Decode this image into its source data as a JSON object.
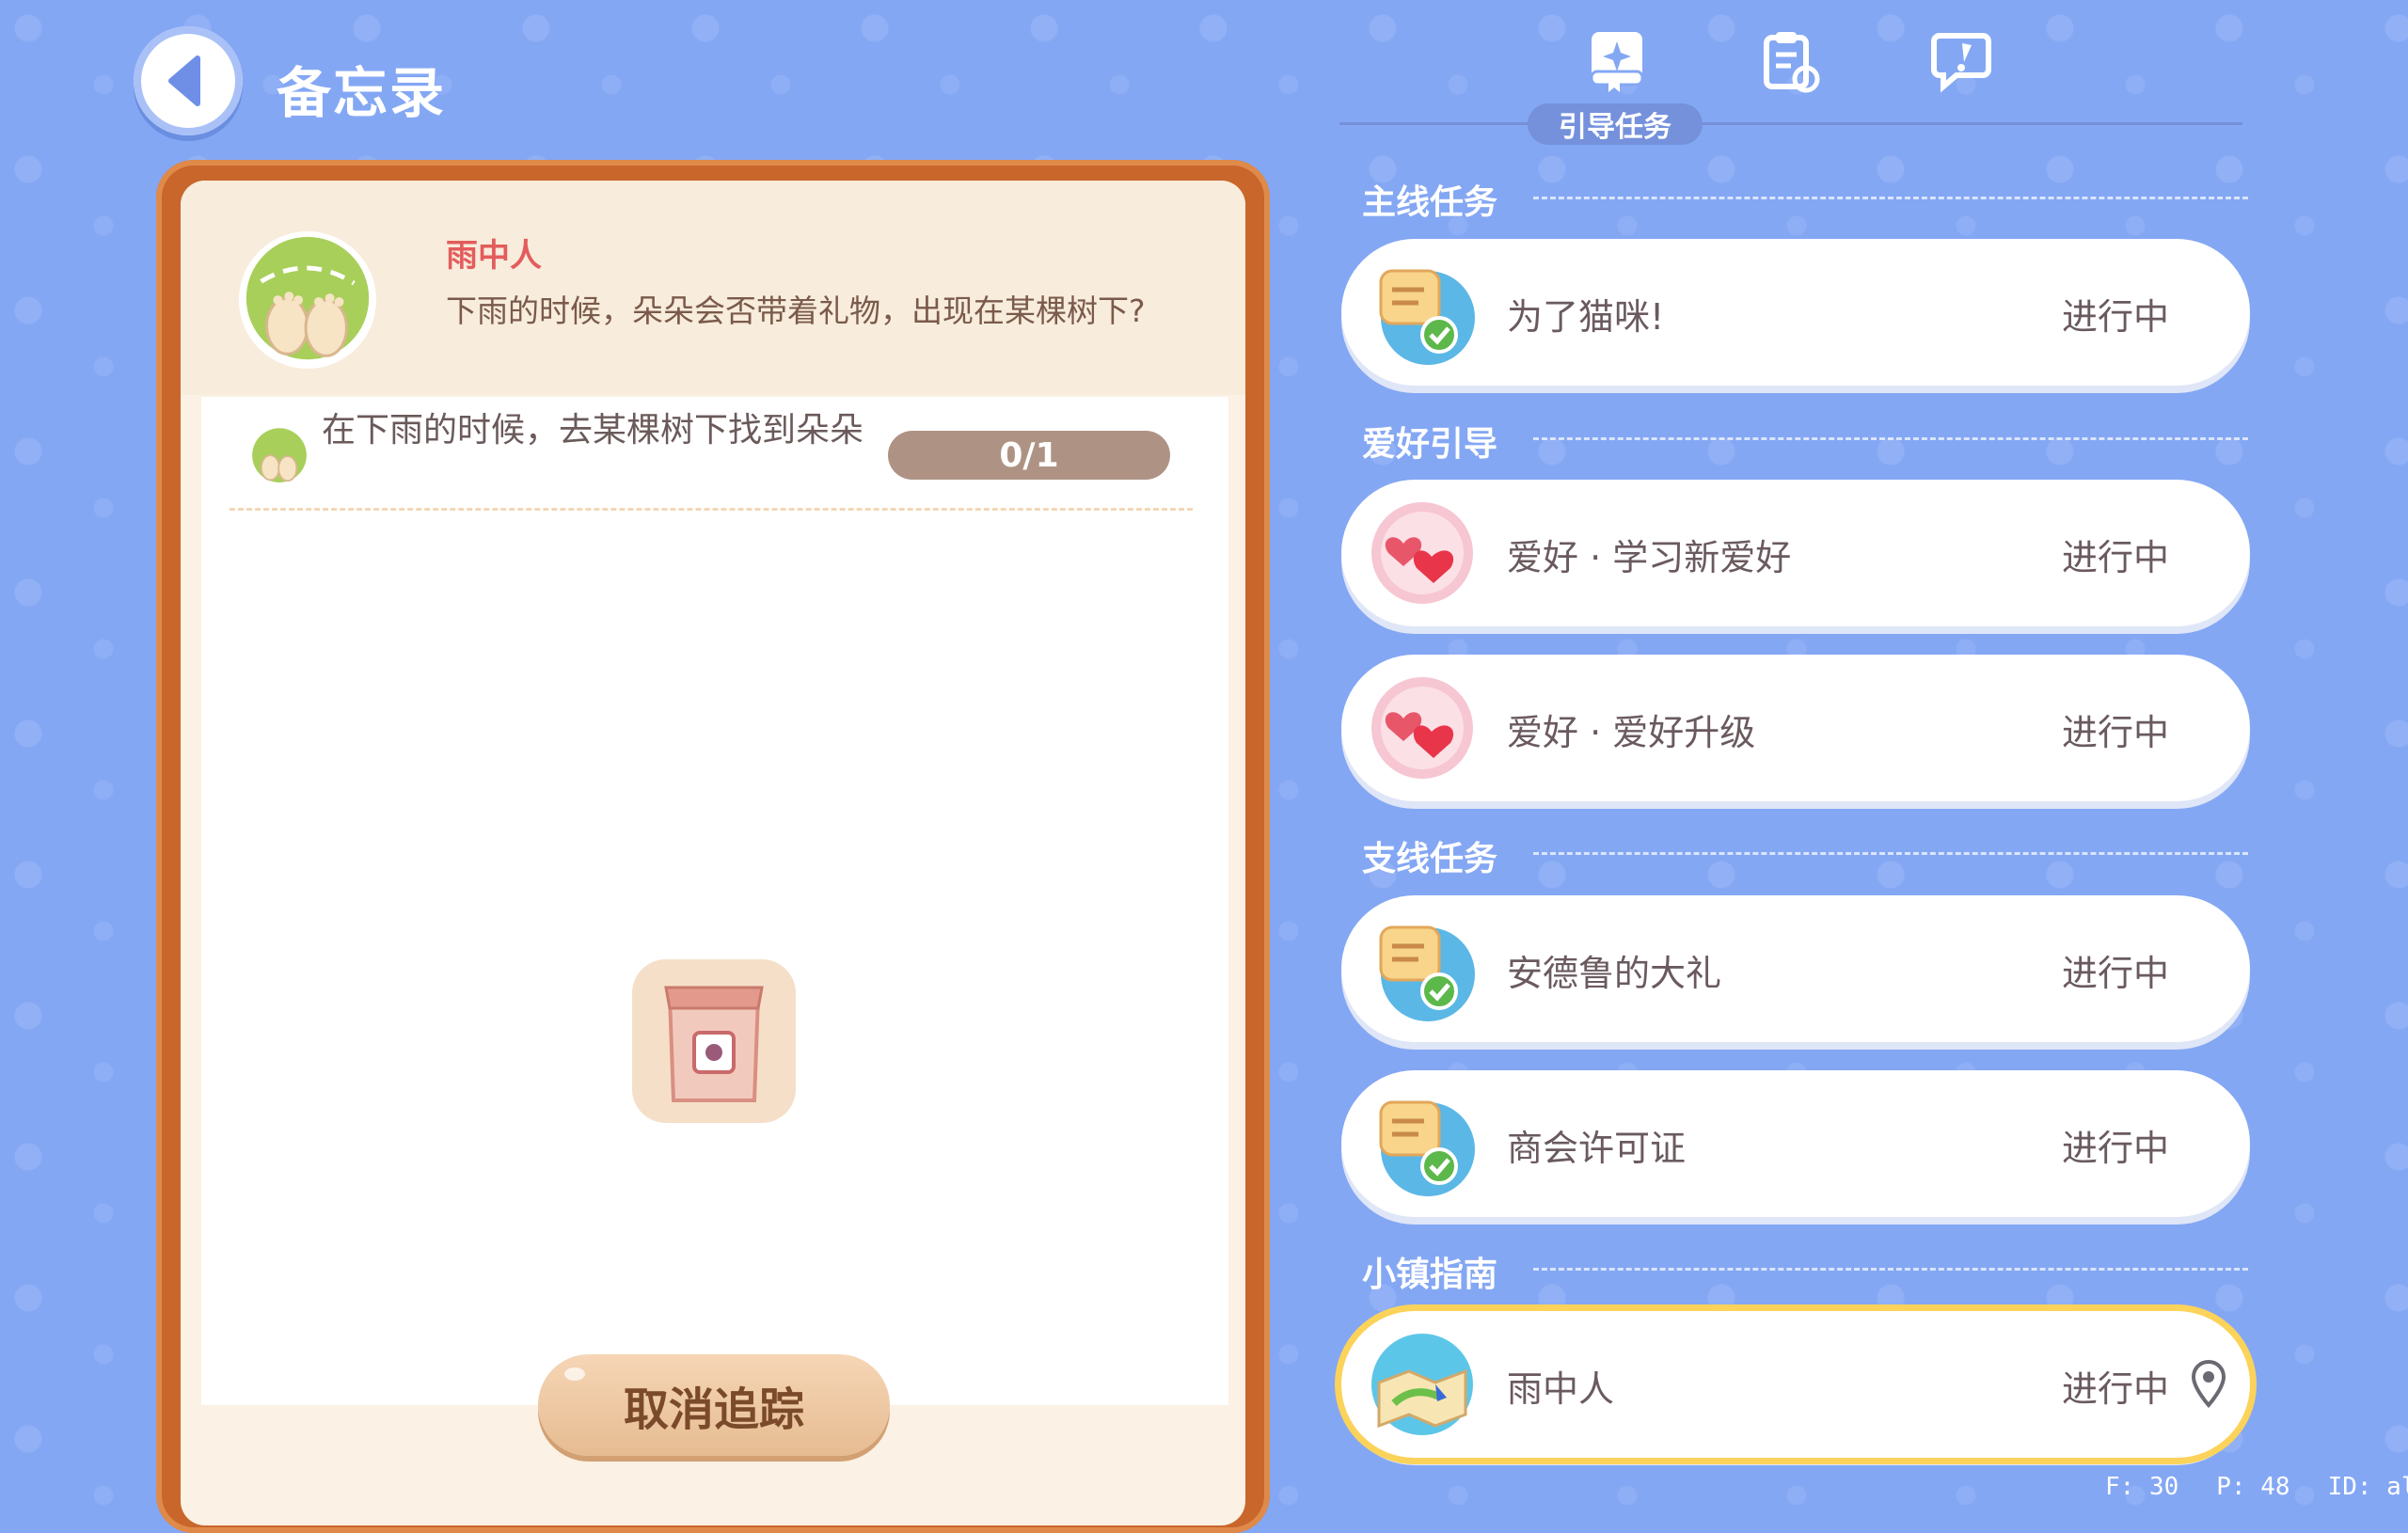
{
  "header": {
    "title": "备忘录"
  },
  "detail": {
    "quest_name": "雨中人",
    "quest_desc": "下雨的时候，朵朵会否带着礼物，出现在某棵树下?",
    "task_text": "在下雨的时候，去某棵树下找到朵朵",
    "progress": "0/1",
    "cancel_label": "取消追踪"
  },
  "tabs": {
    "active_label": "引导任务"
  },
  "sections": [
    {
      "title": "主线任务"
    },
    {
      "title": "爱好引导"
    },
    {
      "title": "支线任务"
    },
    {
      "title": "小镇指南"
    }
  ],
  "quests": [
    {
      "title": "为了猫咪!",
      "status": "进行中",
      "icon": "note-check-icon"
    },
    {
      "title": "爱好 · 学习新爱好",
      "status": "进行中",
      "icon": "hearts-icon"
    },
    {
      "title": "爱好 · 爱好升级",
      "status": "进行中",
      "icon": "hearts-icon"
    },
    {
      "title": "安德鲁的大礼",
      "status": "进行中",
      "icon": "note-check-icon"
    },
    {
      "title": "商会许可证",
      "status": "进行中",
      "icon": "note-check-icon"
    },
    {
      "title": "雨中人",
      "status": "进行中",
      "icon": "map-icon"
    }
  ],
  "debug": {
    "f": "F: 30",
    "p": "P: 48",
    "id": "ID: alexkdy"
  },
  "colors": {
    "background": "#84a7f4",
    "frame": "#c8662c",
    "accent_red": "#e35c5c",
    "active_border": "#fbd35a"
  }
}
